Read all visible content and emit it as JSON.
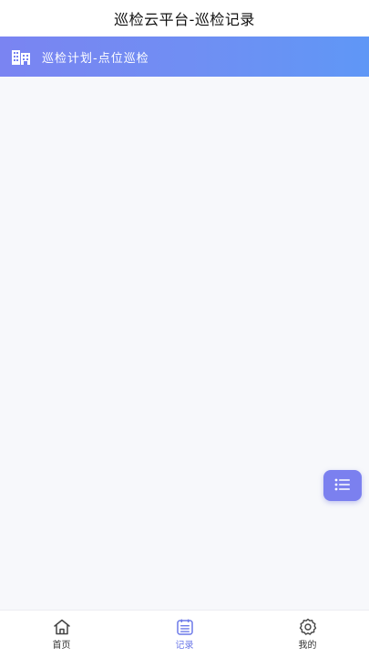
{
  "header": {
    "title": "巡检云平台-巡检记录"
  },
  "banner": {
    "icon": "building-icon",
    "text": "巡检计划-点位巡检"
  },
  "fab": {
    "icon": "list-icon",
    "color": "#7b80ef"
  },
  "tabbar": {
    "items": [
      {
        "label": "首页",
        "icon": "home-icon",
        "active": false
      },
      {
        "label": "记录",
        "icon": "record-icon",
        "active": true
      },
      {
        "label": "我的",
        "icon": "gear-icon",
        "active": false
      }
    ]
  },
  "colors": {
    "accent": "#6c79e8",
    "banner_start": "#7a84f2",
    "banner_end": "#5f97f6",
    "background": "#f7f8fb"
  }
}
